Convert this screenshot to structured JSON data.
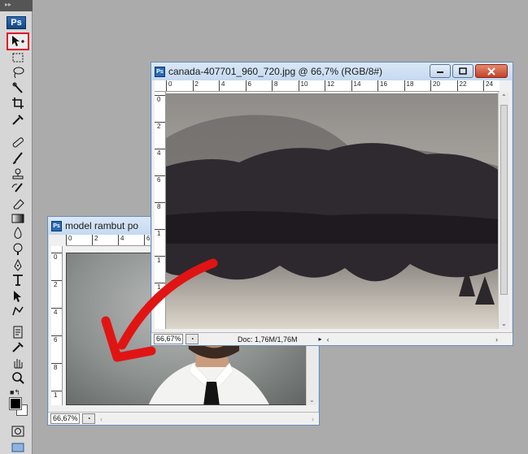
{
  "app": {
    "logo": "Ps",
    "colors": {
      "accent_red": "#e0142a",
      "titlebar": "#c5d9f0",
      "arrow": "#e11414"
    }
  },
  "toolbox": {
    "active_tool": "move-tool",
    "tools": [
      "move-tool-icon",
      "marquee-icon",
      "lasso-icon",
      "quick-select-icon",
      "crop-icon",
      "eyedropper-icon",
      "spot-heal-icon",
      "brush-icon",
      "clone-stamp-icon",
      "history-brush-icon",
      "eraser-icon",
      "gradient-icon",
      "blur-icon",
      "dodge-icon",
      "pen-icon",
      "type-icon",
      "path-select-icon",
      "shape-icon",
      "notes-icon",
      "eyedropper2-icon",
      "hand-icon",
      "zoom-icon"
    ]
  },
  "windows": {
    "canada": {
      "title": "canada-407701_960_720.jpg @ 66,7% (RGB/8#)",
      "zoom": "66,67%",
      "doc_info": "Doc: 1,76M/1,76M",
      "ruler_h": [
        "0",
        "2",
        "4",
        "6",
        "8",
        "10",
        "12",
        "14",
        "16",
        "18",
        "20",
        "22",
        "24"
      ],
      "ruler_v": [
        "0",
        "2",
        "4",
        "6",
        "8",
        "1",
        "1",
        "1"
      ]
    },
    "model": {
      "title": "model rambut po",
      "zoom": "66,67%",
      "ruler_h": [
        "0",
        "2",
        "4",
        "6"
      ],
      "ruler_v": [
        "0",
        "2",
        "4",
        "6",
        "8",
        "1"
      ]
    }
  }
}
